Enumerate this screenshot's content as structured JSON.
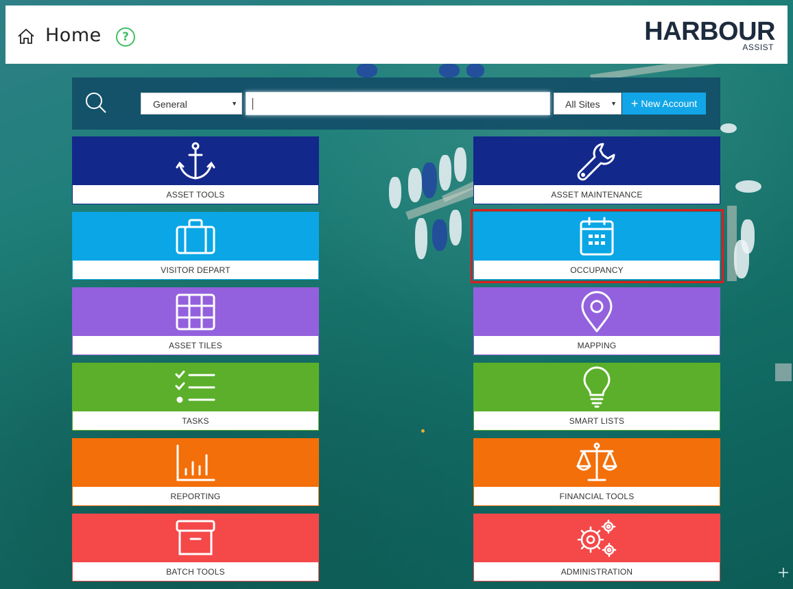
{
  "header": {
    "title": "Home",
    "help_symbol": "?",
    "logo_main": "HARBOUR",
    "logo_sub": "ASSIST",
    "icons": [
      "home-icon",
      "help-icon"
    ]
  },
  "search": {
    "category_selected": "General",
    "query_value": "",
    "site_selected": "All Sites",
    "new_account_label": "New Account",
    "new_account_symbol": "+"
  },
  "tiles": [
    {
      "label": "ASSET TOOLS",
      "icon": "anchor-icon",
      "color": "#13288b"
    },
    {
      "label": "ASSET MAINTENANCE",
      "icon": "wrench-icon",
      "color": "#13288b"
    },
    {
      "label": "VISITOR DEPART",
      "icon": "suitcase-icon",
      "color": "#0aa6e6"
    },
    {
      "label": "OCCUPANCY",
      "icon": "calendar-icon",
      "color": "#0aa6e6"
    },
    {
      "label": "ASSET TILES",
      "icon": "grid-icon",
      "color": "#9361dd"
    },
    {
      "label": "MAPPING",
      "icon": "map-pin-icon",
      "color": "#9361dd"
    },
    {
      "label": "TASKS",
      "icon": "checklist-icon",
      "color": "#5baf2a"
    },
    {
      "label": "SMART LISTS",
      "icon": "lightbulb-icon",
      "color": "#5baf2a"
    },
    {
      "label": "REPORTING",
      "icon": "bar-chart-icon",
      "color": "#f36f0a"
    },
    {
      "label": "FINANCIAL TOOLS",
      "icon": "scales-icon",
      "color": "#f36f0a"
    },
    {
      "label": "BATCH TOOLS",
      "icon": "archive-box-icon",
      "color": "#f44849"
    },
    {
      "label": "ADMINISTRATION",
      "icon": "gears-icon",
      "color": "#f44849"
    }
  ],
  "highlighted_tile": "OCCUPANCY",
  "highlight_color": "#dd1c1c"
}
